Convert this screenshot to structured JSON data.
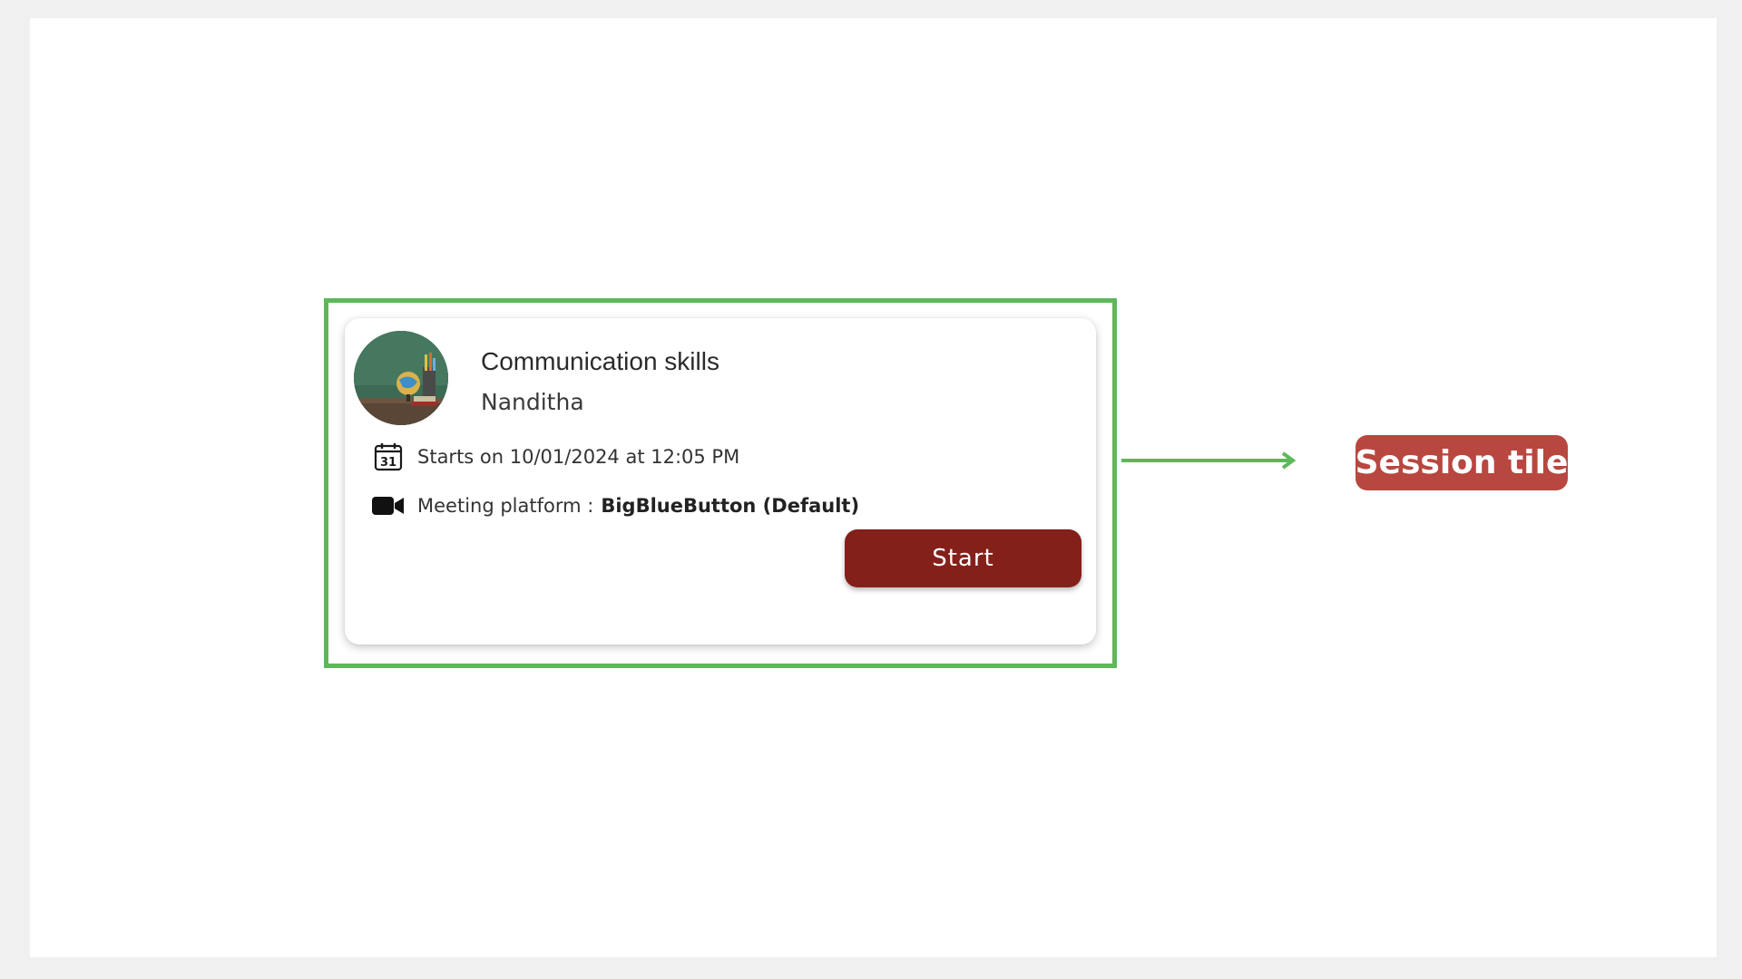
{
  "session_tile": {
    "title": "Communication skills",
    "mentor": "Nanditha",
    "schedule_text": "Starts on 10/01/2024 at 12:05 PM",
    "calendar_day": "31",
    "platform_label": "Meeting platform :",
    "platform_value": "BigBlueButton (Default)",
    "start_label": "Start"
  },
  "callout": {
    "label": "Session tile"
  },
  "colors": {
    "highlight_frame": "#5db85a",
    "arrow": "#5db85a",
    "start_button": "#84201a",
    "callout_badge": "#b8473f"
  },
  "icons": {
    "avatar": "classroom-image",
    "date": "calendar-icon",
    "platform": "video-camera-icon",
    "arrow": "arrow-right-icon"
  }
}
